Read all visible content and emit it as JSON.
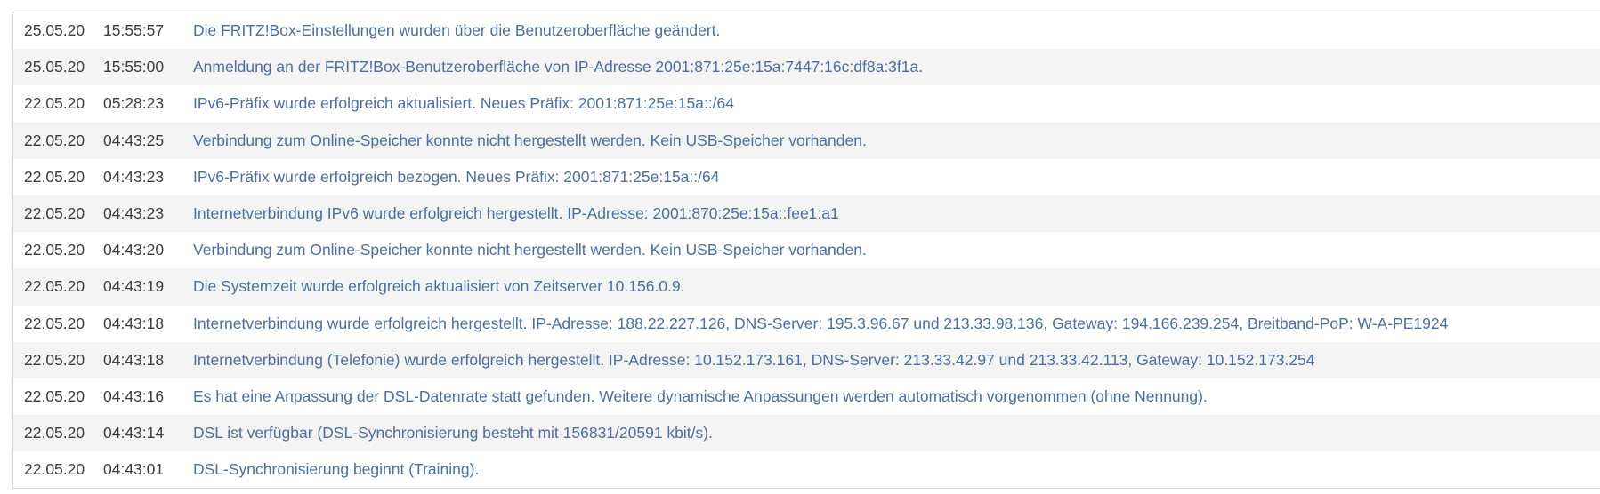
{
  "colors": {
    "message_link": "#4a6fa5",
    "text": "#3c3c3c",
    "row_alt": "#f4f4f4",
    "border": "#d6d6d6"
  },
  "log": {
    "entries": [
      {
        "date": "25.05.20",
        "time": "15:55:57",
        "message": "Die FRITZ!Box-Einstellungen wurden über die Benutzeroberfläche geändert."
      },
      {
        "date": "25.05.20",
        "time": "15:55:00",
        "message": "Anmeldung an der FRITZ!Box-Benutzeroberfläche von IP-Adresse 2001:871:25e:15a:7447:16c:df8a:3f1a."
      },
      {
        "date": "22.05.20",
        "time": "05:28:23",
        "message": "IPv6-Präfix wurde erfolgreich aktualisiert. Neues Präfix: 2001:871:25e:15a::/64"
      },
      {
        "date": "22.05.20",
        "time": "04:43:25",
        "message": "Verbindung zum Online-Speicher konnte nicht hergestellt werden. Kein USB-Speicher vorhanden."
      },
      {
        "date": "22.05.20",
        "time": "04:43:23",
        "message": "IPv6-Präfix wurde erfolgreich bezogen. Neues Präfix: 2001:871:25e:15a::/64"
      },
      {
        "date": "22.05.20",
        "time": "04:43:23",
        "message": "Internetverbindung IPv6 wurde erfolgreich hergestellt. IP-Adresse: 2001:870:25e:15a::fee1:a1"
      },
      {
        "date": "22.05.20",
        "time": "04:43:20",
        "message": "Verbindung zum Online-Speicher konnte nicht hergestellt werden. Kein USB-Speicher vorhanden."
      },
      {
        "date": "22.05.20",
        "time": "04:43:19",
        "message": "Die Systemzeit wurde erfolgreich aktualisiert von Zeitserver 10.156.0.9."
      },
      {
        "date": "22.05.20",
        "time": "04:43:18",
        "message": "Internetverbindung wurde erfolgreich hergestellt. IP-Adresse: 188.22.227.126, DNS-Server: 195.3.96.67 und 213.33.98.136, Gateway: 194.166.239.254, Breitband-PoP: W-A-PE1924"
      },
      {
        "date": "22.05.20",
        "time": "04:43:18",
        "message": "Internetverbindung (Telefonie) wurde erfolgreich hergestellt. IP-Adresse: 10.152.173.161, DNS-Server: 213.33.42.97 und 213.33.42.113, Gateway: 10.152.173.254"
      },
      {
        "date": "22.05.20",
        "time": "04:43:16",
        "message": "Es hat eine Anpassung der DSL-Datenrate statt gefunden. Weitere dynamische Anpassungen werden automatisch vorgenommen (ohne Nennung)."
      },
      {
        "date": "22.05.20",
        "time": "04:43:14",
        "message": "DSL ist verfügbar (DSL-Synchronisierung besteht mit 156831/20591 kbit/s)."
      },
      {
        "date": "22.05.20",
        "time": "04:43:01",
        "message": "DSL-Synchronisierung beginnt (Training)."
      }
    ]
  }
}
